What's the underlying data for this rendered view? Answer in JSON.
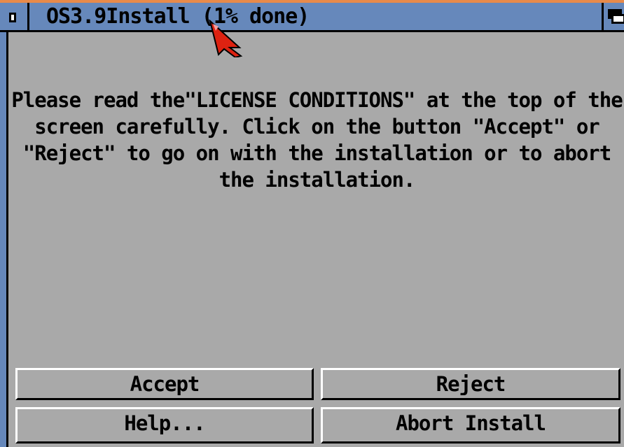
{
  "window": {
    "title": "OS3.9Install (1% done)"
  },
  "message": "Please read the\"LICENSE CONDITIONS\" at the top of the\nscreen carefully. Click on the button \"Accept\" or\n\"Reject\" to go on with the installation or to abort\nthe installation.",
  "buttons": {
    "accept": "Accept",
    "reject": "Reject",
    "help": "Help...",
    "abort": "Abort Install"
  },
  "icons": {
    "close": "close-icon",
    "depth": "depth-arrange-icon",
    "pointer": "mouse-pointer-icon"
  },
  "colors": {
    "titlebar": "#6688bb",
    "background": "#a9a9a9",
    "pointer": "#dd2211"
  }
}
